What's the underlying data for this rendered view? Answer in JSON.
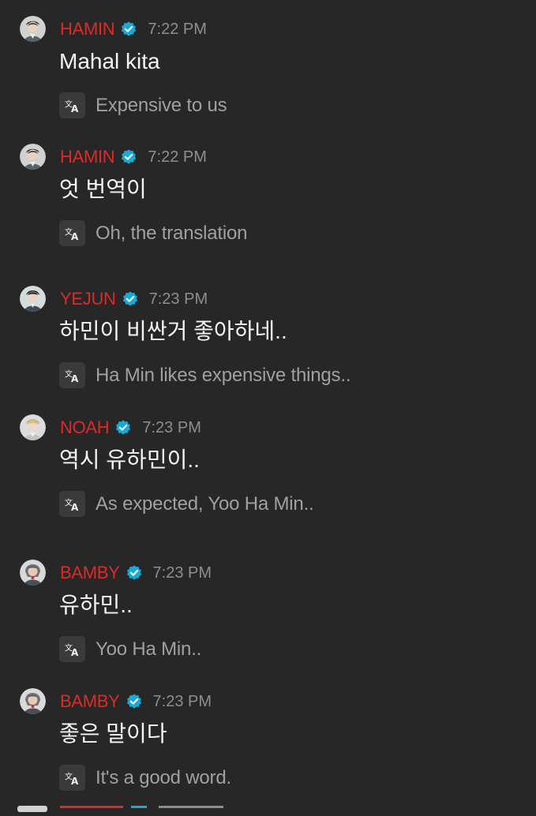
{
  "messages": [
    {
      "username": "HAMIN",
      "time": "7:22 PM",
      "original": "Mahal kita",
      "translation": "Expensive to us",
      "avatar_icon": "user-avatar-icon",
      "verified_icon": "verified-badge-icon",
      "translate_icon": "translate-icon"
    },
    {
      "username": "HAMIN",
      "time": "7:22 PM",
      "original": "엇 번역이",
      "translation": "Oh, the translation",
      "avatar_icon": "user-avatar-icon",
      "verified_icon": "verified-badge-icon",
      "translate_icon": "translate-icon"
    },
    {
      "username": "YEJUN",
      "time": "7:23 PM",
      "original": "하민이 비싼거 좋아하네..",
      "translation": "Ha Min likes expensive things..",
      "avatar_icon": "user-avatar-icon",
      "verified_icon": "verified-badge-icon",
      "translate_icon": "translate-icon"
    },
    {
      "username": "NOAH",
      "time": "7:23 PM",
      "original": "역시 유하민이..",
      "translation": "As expected, Yoo Ha Min..",
      "avatar_icon": "user-avatar-icon",
      "verified_icon": "verified-badge-icon",
      "translate_icon": "translate-icon"
    },
    {
      "username": "BAMBY",
      "time": "7:23 PM",
      "original": "유하민..",
      "translation": "Yoo Ha Min..",
      "avatar_icon": "user-avatar-icon",
      "verified_icon": "verified-badge-icon",
      "translate_icon": "translate-icon"
    },
    {
      "username": "BAMBY",
      "time": "7:23 PM",
      "original": "좋은 말이다",
      "translation": "It's a good word.",
      "avatar_icon": "user-avatar-icon",
      "verified_icon": "verified-badge-icon",
      "translate_icon": "translate-icon"
    }
  ],
  "colors": {
    "background": "#272727",
    "username": "#dd2a28",
    "timestamp": "#8e8e8e",
    "message_text": "#f4f4f4",
    "translation_text": "#a0a0a0",
    "verified_badge": "#19a9d6",
    "translate_button": "#3a3a3a"
  }
}
